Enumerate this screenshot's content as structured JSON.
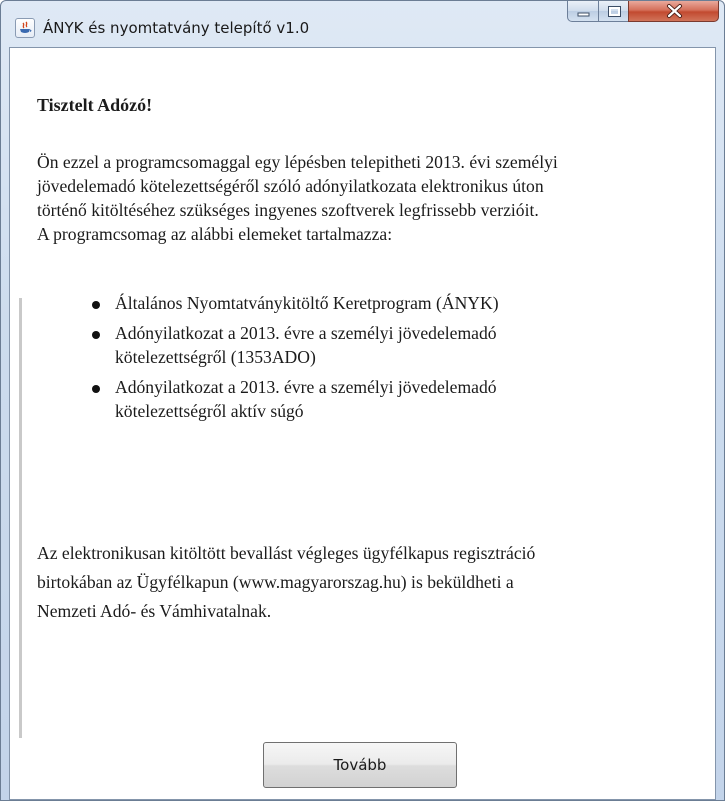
{
  "window": {
    "title": "ÁNYK és nyomtatvány telepítő v1.0",
    "controls": [
      "minimize-icon",
      "maximize-icon",
      "close-icon"
    ],
    "close_color": "#c9503a"
  },
  "content": {
    "greeting": "Tisztelt Adózó!",
    "intro_lines": [
      "Ön ezzel a programcsomaggal egy lépésben telepitheti 2013. évi személyi",
      "jövedelemadó kötelezettségéről szóló adónyilatkozata elektronikus úton",
      "történő kitöltéséhez szükséges ingyenes szoftverek legfrissebb verzióit.",
      "A programcsomag az alábbi elemeket tartalmazza:"
    ],
    "items": [
      {
        "lines": [
          "Általános Nyomtatványkitöltő Keretprogram (ÁNYK)"
        ]
      },
      {
        "lines": [
          "Adónyilatkozat a 2013. évre a személyi jövedelemadó",
          "kötelezettségről (1353ADO)"
        ]
      },
      {
        "lines": [
          "Adónyilatkozat a 2013. évre a személyi jövedelemadó",
          "kötelezettségről aktív súgó"
        ]
      }
    ],
    "footer_lines": [
      "Az elektronikusan kitöltött bevallást végleges ügyfélkapus regisztráció",
      "birtokában az Ügyfélkapun (www.magyarorszag.hu) is beküldheti a",
      "Nemzeti Adó- és Vámhivatalnak."
    ]
  },
  "buttons": {
    "next_label": "Tovább"
  }
}
